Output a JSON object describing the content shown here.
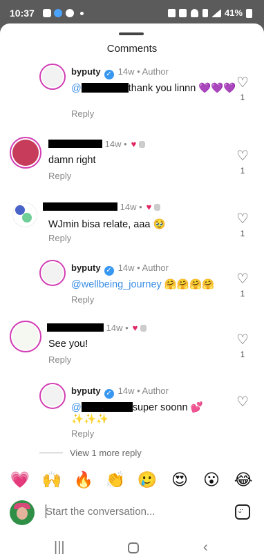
{
  "status_bar": {
    "time": "10:37",
    "battery": "41%"
  },
  "sheet": {
    "title": "Comments"
  },
  "comments": [
    {
      "username": "byputy",
      "verified": true,
      "time": "14w",
      "tag": "Author",
      "mention": "@",
      "text": "thank you linnn 💜💜💜",
      "reply": "Reply",
      "likes": "1"
    },
    {
      "username": "",
      "time": "14w",
      "text": "damn right",
      "reply": "Reply",
      "likes": "1"
    },
    {
      "username": "",
      "time": "14w",
      "text": "WJmin bisa relate, aaa 🥹",
      "reply": "Reply",
      "likes": "1"
    },
    {
      "username": "byputy",
      "verified": true,
      "time": "14w",
      "tag": "Author",
      "mention": "@wellbeing_journey",
      "text": "🤗🤗🤗🤗",
      "reply": "Reply",
      "likes": "1"
    },
    {
      "username": "",
      "time": "14w",
      "text": "See you!",
      "reply": "Reply",
      "likes": "1"
    },
    {
      "username": "byputy",
      "verified": true,
      "time": "14w",
      "tag": "Author",
      "mention": "@",
      "text": "super soonn 💕",
      "text2": "✨✨✨",
      "reply": "Reply",
      "likes": ""
    }
  ],
  "view_more": "View 1 more reply",
  "reactions": [
    "💗",
    "🙌",
    "🔥",
    "👏",
    "🥲",
    "😍",
    "😮",
    "😂"
  ],
  "composer": {
    "placeholder": "Start the conversation..."
  },
  "icons": {
    "heart": "heart-outline-icon",
    "verified": "verified-badge-icon",
    "sticker": "sticker-icon"
  },
  "colors": {
    "mention": "#3a8ee6",
    "verified": "#3897f0",
    "ring": "#d23eb4",
    "heart_red": "#e0245e"
  }
}
